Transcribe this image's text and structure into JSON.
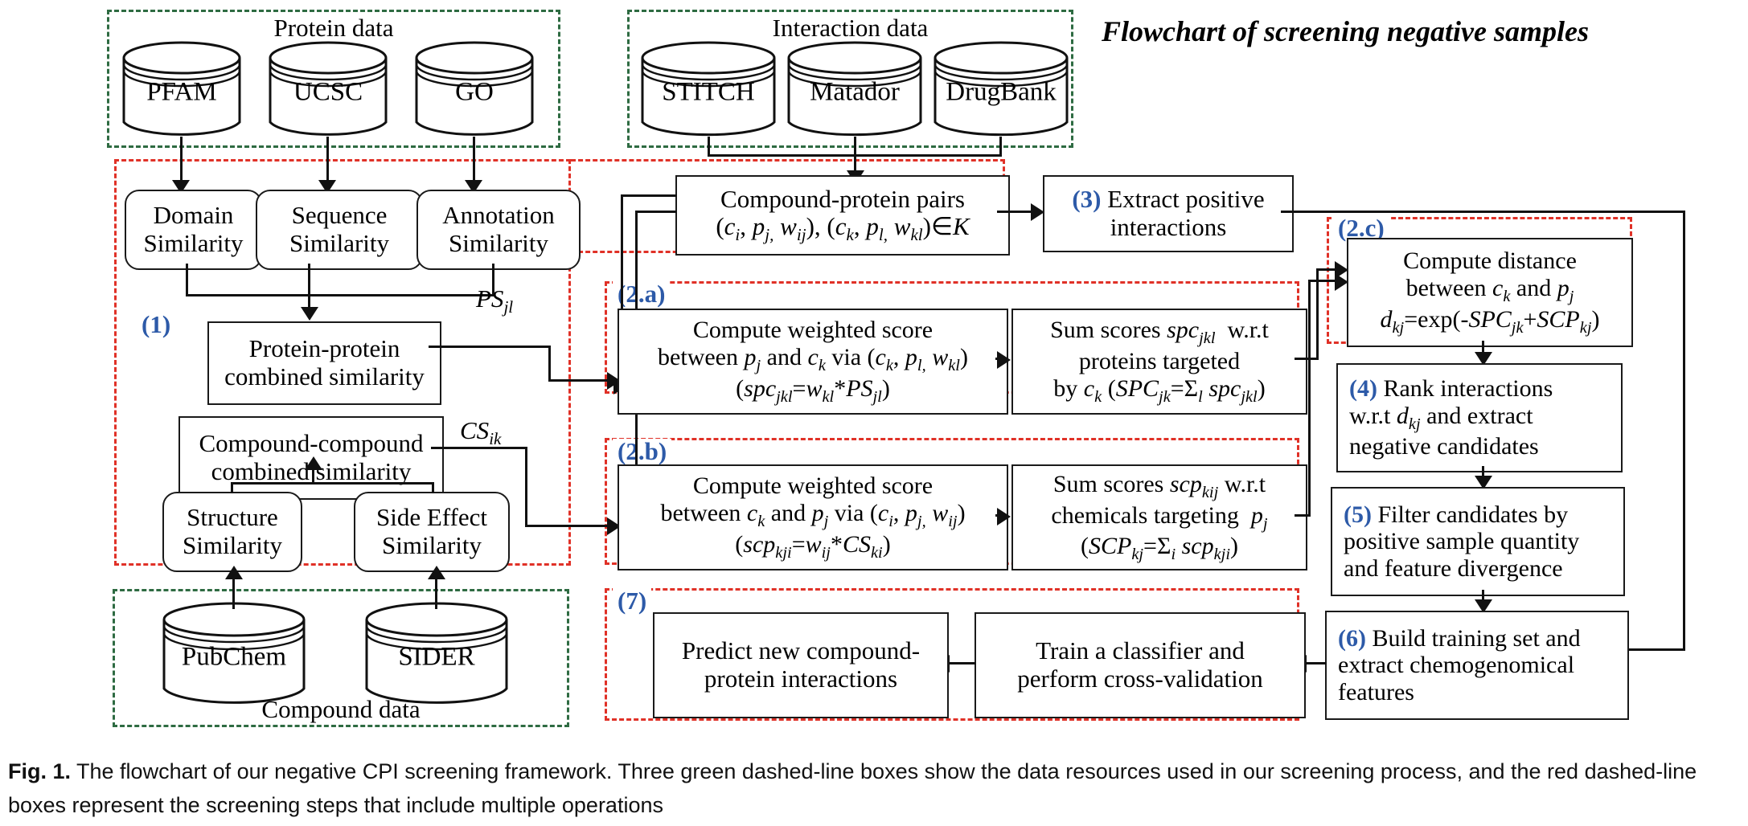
{
  "headline": "Flowchart of screening negative samples",
  "groups": {
    "protein_data": {
      "title": "Protein data",
      "color": "#2e6b42"
    },
    "interaction_data": {
      "title": "Interaction data",
      "color": "#2e6b42"
    },
    "compound_data": {
      "title": "Compound data",
      "color": "#2e6b42"
    },
    "step1": {
      "tag": "(1)",
      "color": "#e03127"
    },
    "step2a": {
      "tag": "(2.a)",
      "color": "#e03127"
    },
    "step2b": {
      "tag": "(2.b)",
      "color": "#e03127"
    },
    "step2c": {
      "tag": "(2.c)",
      "color": "#e03127"
    },
    "step7": {
      "tag": "(7)",
      "color": "#e03127"
    }
  },
  "databases": {
    "pfam": "PFAM",
    "ucsc": "UCSC",
    "go": "GO",
    "stitch": "STITCH",
    "matador": "Matador",
    "drugbank": "DrugBank",
    "pubchem": "PubChem",
    "sider": "SIDER"
  },
  "boxes": {
    "domain_similarity": "Domain\nSimilarity",
    "sequence_similarity": "Sequence\nSimilarity",
    "annotation_similarity": "Annotation\nSimilarity",
    "protein_protein": "Protein-protein\ncombined similarity",
    "compound_compound": "Compound-compound\ncombined similarity",
    "structure_similarity": "Structure\nSimilarity",
    "side_effect_similarity": "Side Effect\nSimilarity",
    "predict_new": "Predict new compound-\nprotein interactions",
    "train_classifier": "Train a classifier and\nperform cross-validation"
  },
  "labels": {
    "ps_jl": "PS",
    "ps_jl_sub": "jl",
    "cs_ik": "CS",
    "cs_ik_sub": "ik"
  },
  "cp_pairs": {
    "line1": "Compound-protein pairs",
    "line2_plain": "(c_i, p_j, w_ij), (c_k, p_l, w_kl) ∈ K"
  },
  "step3": {
    "num": "(3)",
    "text": "Extract positive\ninteractions"
  },
  "step2a_left": {
    "line1": "Compute weighted score",
    "line2": "between p_j and c_k via (c_k, p_l, w_kl)",
    "line3": "(spc_jkl = w_kl * PS_jl)"
  },
  "step2a_right": {
    "line1": "Sum scores spc_jkl  w.r.t",
    "line2": "proteins targeted",
    "line3": "by c_k (SPC_jk = Σ_l spc_jkl)"
  },
  "step2b_left": {
    "line1": "Compute weighted score",
    "line2": "between c_k and p_j via (c_i, p_j, w_ij)",
    "line3": "(scp_kji = w_ij * CS_ki)"
  },
  "step2b_right": {
    "line1": "Sum scores scp_kij w.r.t",
    "line2": "chemicals targeting  p_j",
    "line3": "(SCP_kj = Σ_i scp_kji)"
  },
  "step2c_box": {
    "line1": "Compute distance",
    "line2": "between c_k and p_j",
    "line3": "d_kj = exp(-SPC_jk + SCP_kj)"
  },
  "step4": {
    "num": "(4)",
    "line1": "Rank interactions",
    "line2": "w.r.t d_kj and extract",
    "line3": "negative candidates"
  },
  "step5": {
    "num": "(5)",
    "line1": "Filter candidates by",
    "line2": "positive sample quantity",
    "line3": "and feature divergence"
  },
  "step6": {
    "num": "(6)",
    "line1": "Build training set and",
    "line2": "extract chemogenomical",
    "line3": "features"
  },
  "caption": {
    "prefix": "Fig. 1.",
    "text": " The flowchart of our negative CPI screening framework. Three green dashed-line boxes show the data resources used in our screening process, and the red dashed-line boxes represent the screening steps that include multiple operations"
  }
}
